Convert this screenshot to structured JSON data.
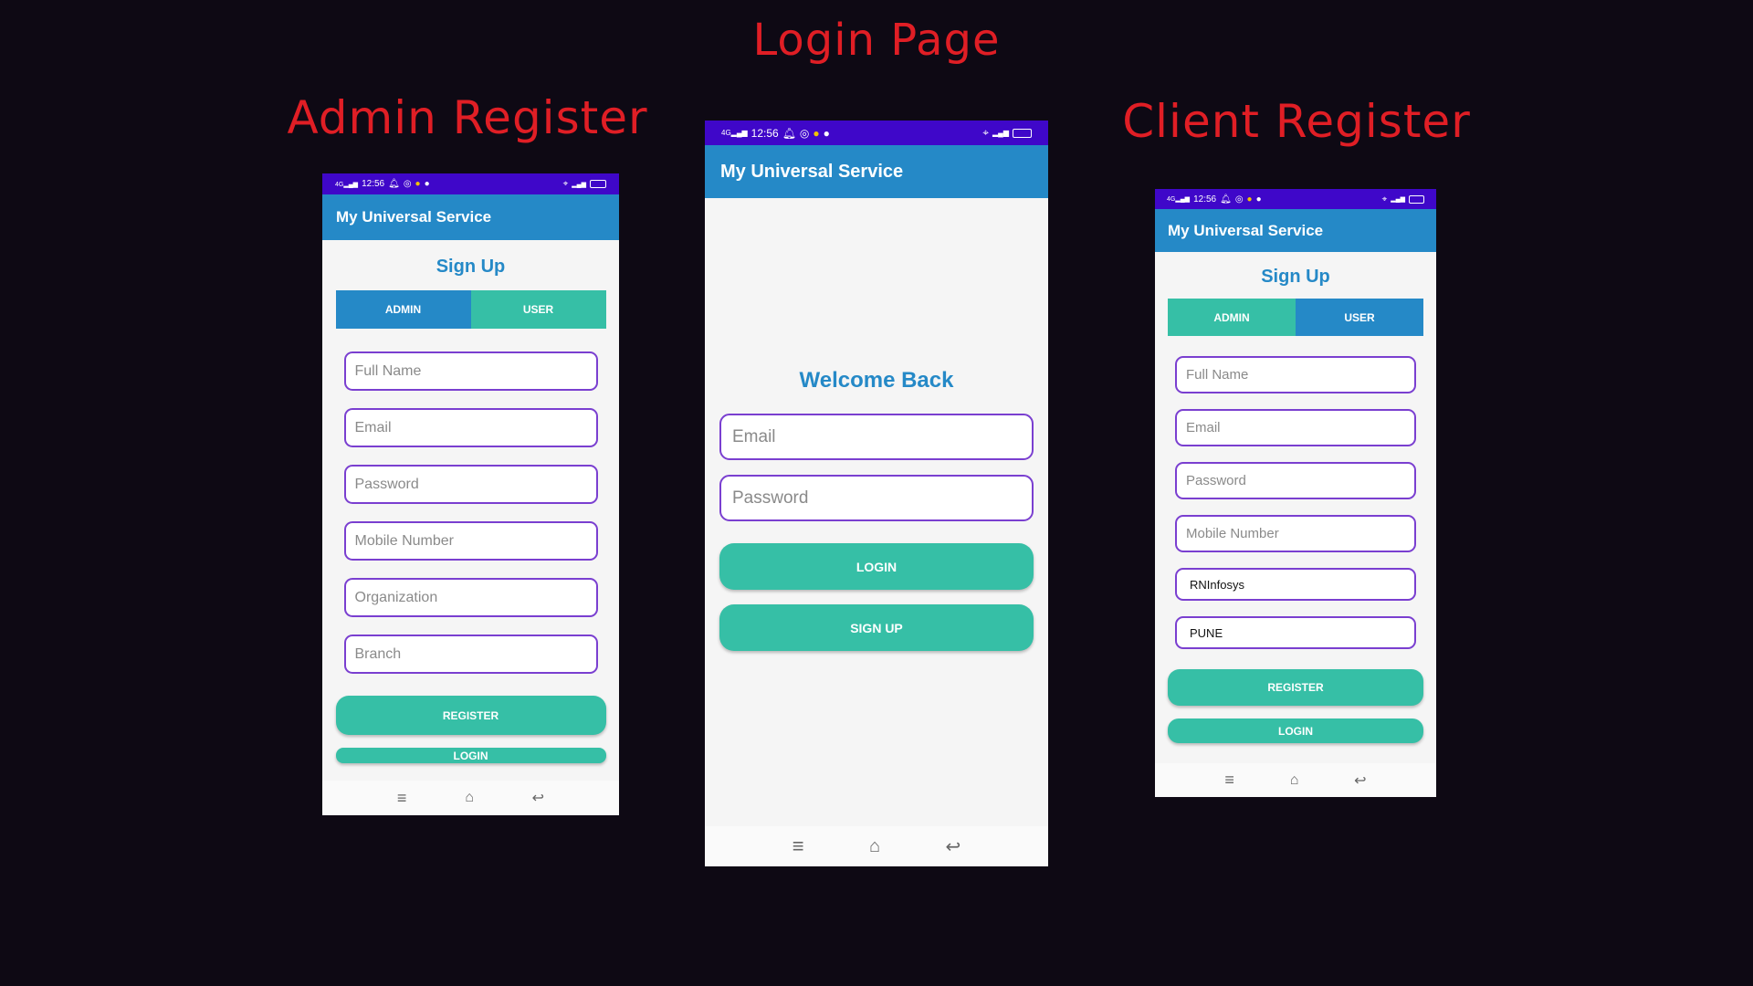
{
  "headings": {
    "center": "Login Page",
    "left": "Admin Register",
    "right": "Client Register"
  },
  "status_bar": {
    "time": "12:56",
    "network": "4G"
  },
  "app": {
    "title": "My Universal Service"
  },
  "admin_register": {
    "title": "Sign Up",
    "tabs": {
      "admin": "ADMIN",
      "user": "USER"
    },
    "fields": {
      "full_name": "Full Name",
      "email": "Email",
      "password": "Password",
      "mobile": "Mobile Number",
      "organization": "Organization",
      "branch": "Branch"
    },
    "register_label": "REGISTER",
    "login_label": "LOGIN"
  },
  "login_page": {
    "welcome": "Welcome Back",
    "fields": {
      "email": "Email",
      "password": "Password"
    },
    "login_label": "LOGIN",
    "signup_label": "SIGN UP"
  },
  "client_register": {
    "title": "Sign Up",
    "tabs": {
      "admin": "ADMIN",
      "user": "USER"
    },
    "fields": {
      "full_name": "Full Name",
      "email": "Email",
      "password": "Password",
      "mobile": "Mobile Number",
      "organization_value": "RNInfosys",
      "branch_value": "PUNE"
    },
    "register_label": "REGISTER",
    "login_label": "LOGIN"
  },
  "colors": {
    "background": "#0e0914",
    "heading": "#e01e25",
    "status_bar": "#3f07c9",
    "app_bar": "#2589c7",
    "accent_teal": "#36bfa6",
    "field_border": "#7a3fd0"
  },
  "icons": [
    "signal-icon",
    "bell-icon",
    "instagram-icon",
    "notification-icon",
    "location-icon",
    "wifi-icon",
    "battery-icon",
    "menu-icon",
    "home-icon",
    "back-icon"
  ]
}
